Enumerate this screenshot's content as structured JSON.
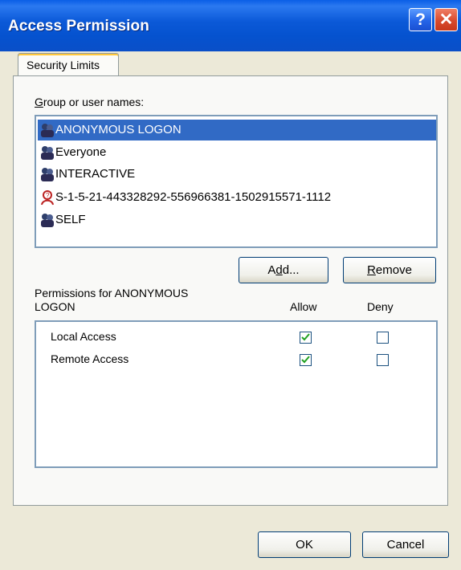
{
  "window": {
    "title": "Access Permission"
  },
  "titlebar_buttons": {
    "help": "?",
    "close": "✕"
  },
  "tabs": [
    {
      "label": "Security Limits"
    }
  ],
  "group_list": {
    "label": "Group or user names:",
    "selected_index": 0,
    "items": [
      {
        "name": "ANONYMOUS LOGON",
        "icon": "group-icon"
      },
      {
        "name": "Everyone",
        "icon": "group-icon"
      },
      {
        "name": "INTERACTIVE",
        "icon": "group-icon"
      },
      {
        "name": "S-1-5-21-443328292-556966381-1502915571-1112",
        "icon": "unknown-user-icon"
      },
      {
        "name": "SELF",
        "icon": "group-icon"
      }
    ]
  },
  "buttons": {
    "add": "Add...",
    "remove": "Remove",
    "ok": "OK",
    "cancel": "Cancel"
  },
  "permissions": {
    "label_line1": "Permissions for ANONYMOUS",
    "label_line2": "LOGON",
    "col_allow": "Allow",
    "col_deny": "Deny",
    "rows": [
      {
        "name": "Local Access",
        "allow": true,
        "deny": false
      },
      {
        "name": "Remote Access",
        "allow": true,
        "deny": false
      }
    ]
  },
  "colors": {
    "selection": "#316ac5",
    "titlebar": "#0a59d8",
    "check": "#21a121"
  }
}
